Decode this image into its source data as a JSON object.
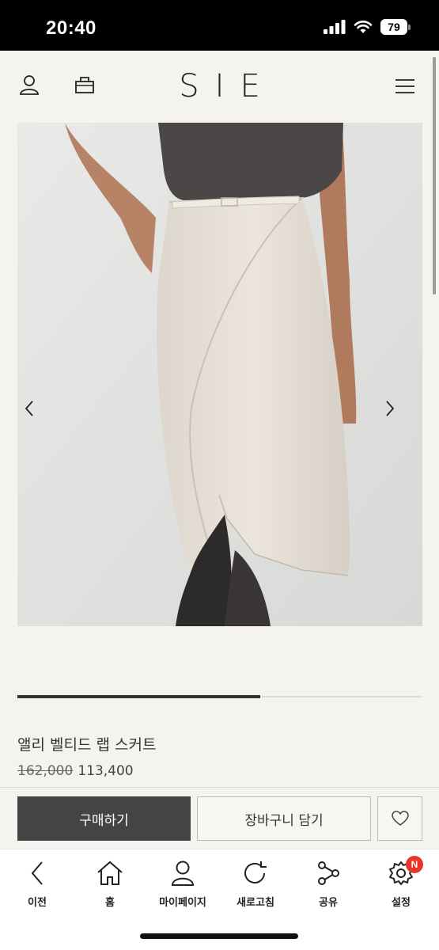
{
  "status_bar": {
    "time": "20:40",
    "battery": "79"
  },
  "header": {
    "logo": "SIE"
  },
  "product": {
    "name": "앨리 벨티드 랩 스커트",
    "original_price": "162,000",
    "sale_price": "113,400",
    "gallery_progress": 0.6
  },
  "actions": {
    "buy_label": "구매하기",
    "cart_label": "장바구니 담기"
  },
  "bottom_nav": {
    "items": [
      {
        "label": "이전",
        "icon": "back-icon"
      },
      {
        "label": "홈",
        "icon": "home-icon"
      },
      {
        "label": "마이페이지",
        "icon": "user-icon"
      },
      {
        "label": "새로고침",
        "icon": "refresh-icon"
      },
      {
        "label": "공유",
        "icon": "share-icon"
      },
      {
        "label": "설정",
        "icon": "gear-icon"
      }
    ],
    "settings_badge": "N"
  },
  "colors": {
    "buy_button": "#444444",
    "badge": "#e8352a",
    "background": "#f4f3ef"
  }
}
